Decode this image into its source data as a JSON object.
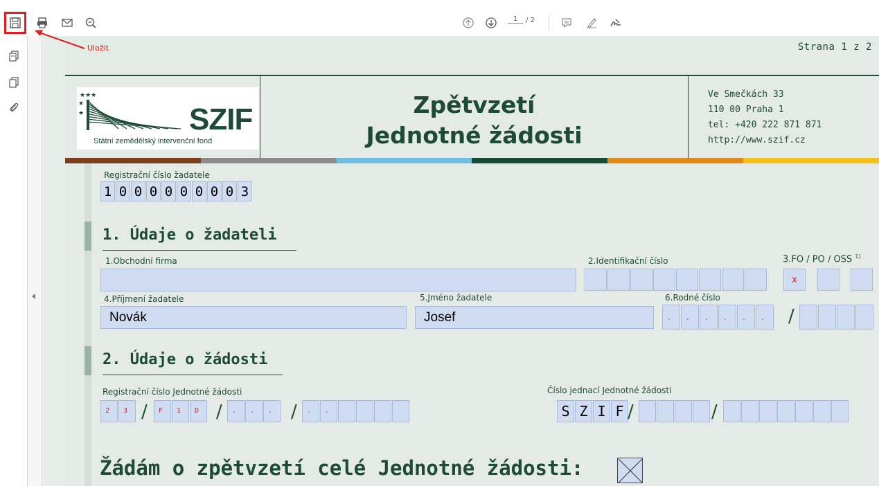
{
  "toolbar": {
    "page_current": "1",
    "page_total": "/ 2",
    "icons": [
      "save-icon",
      "print-icon",
      "email-icon",
      "zoom-icon",
      "page-up-icon",
      "page-down-icon",
      "comment-icon",
      "highlight-icon",
      "sign-icon"
    ]
  },
  "sidebar": {
    "icons": [
      "thumbnails-icon",
      "pages-icon",
      "attachments-icon"
    ]
  },
  "annotation": {
    "label": "Uložit",
    "color": "#e02020"
  },
  "page": {
    "strana": "Strana 1 z 2",
    "logo_text": "SZIF",
    "logo_sub": "Státní zemědělský intervenční fond",
    "title_line1": "Zpětvzetí",
    "title_line2": "Jednotné žádosti",
    "address": [
      "Ve Smečkách 33",
      "110 00 Praha 1",
      "tel: +420 222 871 871",
      "http://www.szif.cz"
    ],
    "color_bar": [
      "#7a3e1a",
      "#888888",
      "#6fbde0",
      "#174b36",
      "#e08a1e",
      "#f2c21a"
    ]
  },
  "registration": {
    "label": "Registrační číslo žadatele",
    "digits": [
      "1",
      "0",
      "0",
      "0",
      "0",
      "0",
      "0",
      "0",
      "0",
      "3"
    ]
  },
  "section1": {
    "title": "1. Údaje o žadateli",
    "obchodni_firma_label": "1.Obchodní firma",
    "identifikacni_label": "2.Identifikační číslo",
    "fo_po_oss_label": "3.FO / PO / OSS",
    "fo_po_oss_note": "1)",
    "fo_mark": "x",
    "prijmeni_label": "4.Příjmení žadatele",
    "prijmeni_value": "Novák",
    "jmeno_label": "5.Jméno žadatele",
    "jmeno_value": "Josef",
    "rodne_label": "6.Rodné číslo"
  },
  "section2": {
    "title": "2. Údaje o žádosti",
    "reg_js_label": "Registrační číslo Jednotné žádosti",
    "reg_js_cells": [
      "2",
      "3",
      "F",
      "1",
      "D"
    ],
    "cj_label": "Číslo jednací Jednotné žádosti",
    "cj_cells": [
      "S",
      "Z",
      "I",
      "F"
    ]
  },
  "final": {
    "text": "Žádám o zpětvzetí celé Jednotné žádosti:"
  }
}
